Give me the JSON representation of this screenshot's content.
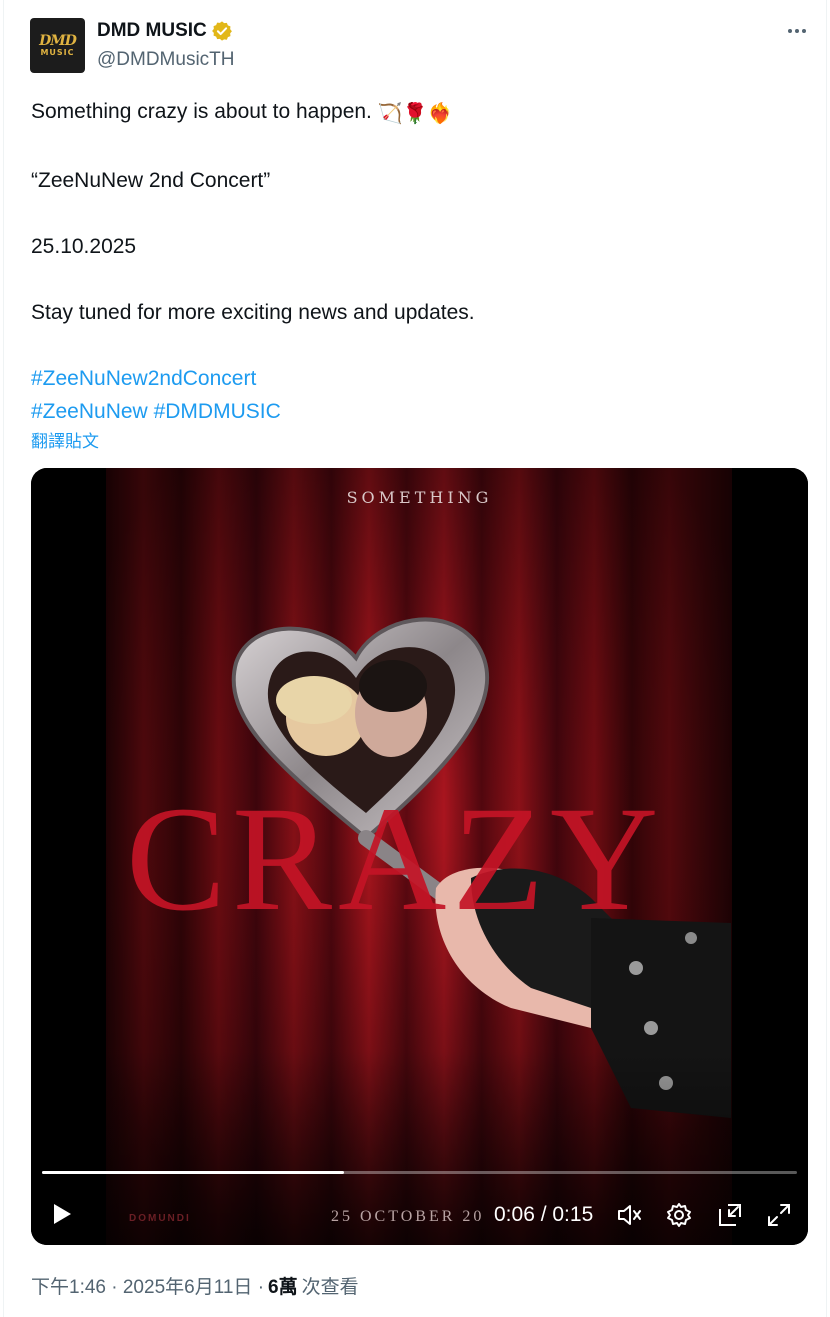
{
  "account": {
    "display_name": "DMD MUSIC",
    "handle": "@DMDMusicTH",
    "avatar_logo": "DMD",
    "avatar_logo_sub": "MUSIC",
    "verified_color": "#e2b719"
  },
  "tweet": {
    "line1": "Something crazy is about to happen.",
    "line1_emojis": [
      "🏹",
      "🌹",
      "❤️‍🔥"
    ],
    "line2": "“ZeeNuNew 2nd Concert”",
    "line3": "25.10.2025",
    "line4": "Stay tuned for more exciting news and updates.",
    "hashtag1": "#ZeeNuNew2ndConcert",
    "hashtag2": "#ZeeNuNew",
    "hashtag3": "#DMDMUSIC",
    "translate_label": "翻譯貼文"
  },
  "media": {
    "poster_top_text": "SOMETHING",
    "poster_title": "CRAZY",
    "poster_brand": "DOMUNDI",
    "poster_date": "25 OCTOBER 20",
    "time_display": "0:06 / 0:15",
    "progress_fraction": 0.4,
    "accent_red": "#c41426"
  },
  "meta": {
    "timestamp": "下午1:46 · 2025年6月11日 ·",
    "views_count": "6萬",
    "views_label": "次查看"
  },
  "colors": {
    "link": "#1d9bf0",
    "secondary_text": "#536471"
  }
}
